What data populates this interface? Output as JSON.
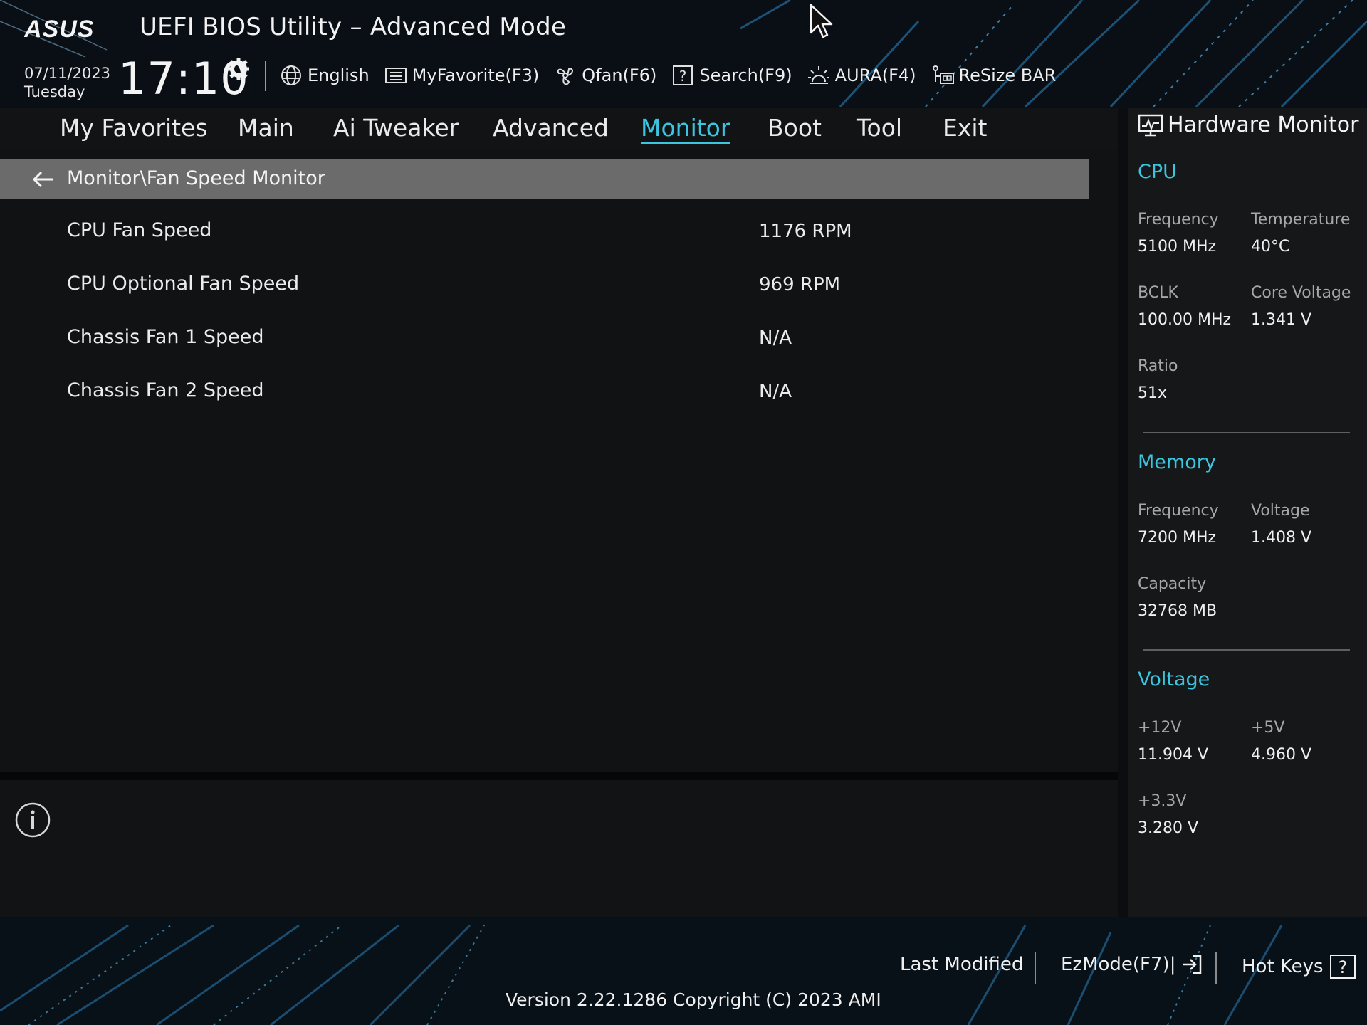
{
  "header": {
    "brand": "ASUS",
    "title": "UEFI BIOS Utility – Advanced Mode",
    "date": "07/11/2023",
    "weekday": "Tuesday",
    "time": "17:10",
    "toolbar": [
      {
        "icon": "globe-icon",
        "label": "English"
      },
      {
        "icon": "favorite-list-icon",
        "label": "MyFavorite(F3)"
      },
      {
        "icon": "fan-icon",
        "label": "Qfan(F6)"
      },
      {
        "icon": "question-box-icon",
        "label": "Search(F9)"
      },
      {
        "icon": "aura-light-icon",
        "label": "AURA(F4)"
      },
      {
        "icon": "resize-bar-icon",
        "label": "ReSize BAR"
      }
    ]
  },
  "tabs": [
    {
      "label": "My Favorites",
      "active": false
    },
    {
      "label": "Main",
      "active": false
    },
    {
      "label": "Ai Tweaker",
      "active": false
    },
    {
      "label": "Advanced",
      "active": false
    },
    {
      "label": "Monitor",
      "active": true
    },
    {
      "label": "Boot",
      "active": false
    },
    {
      "label": "Tool",
      "active": false
    },
    {
      "label": "Exit",
      "active": false
    }
  ],
  "breadcrumb": "Monitor\\Fan Speed Monitor",
  "rows": [
    {
      "label": "CPU Fan Speed",
      "value": "1176 RPM"
    },
    {
      "label": "CPU Optional Fan Speed",
      "value": "969 RPM"
    },
    {
      "label": "Chassis Fan 1 Speed",
      "value": "N/A"
    },
    {
      "label": "Chassis Fan 2 Speed",
      "value": "N/A"
    }
  ],
  "hardware_monitor": {
    "title": "Hardware Monitor",
    "cpu": {
      "title": "CPU",
      "frequency_label": "Frequency",
      "frequency": "5100 MHz",
      "temperature_label": "Temperature",
      "temperature": "40°C",
      "bclk_label": "BCLK",
      "bclk": "100.00 MHz",
      "core_voltage_label": "Core Voltage",
      "core_voltage": "1.341 V",
      "ratio_label": "Ratio",
      "ratio": "51x"
    },
    "memory": {
      "title": "Memory",
      "frequency_label": "Frequency",
      "frequency": "7200 MHz",
      "voltage_label": "Voltage",
      "voltage": "1.408 V",
      "capacity_label": "Capacity",
      "capacity": "32768 MB"
    },
    "voltage": {
      "title": "Voltage",
      "v12_label": "+12V",
      "v12": "11.904 V",
      "v5_label": "+5V",
      "v5": "4.960 V",
      "v33_label": "+3.3V",
      "v33": "3.280 V"
    }
  },
  "footer": {
    "last_modified": "Last Modified",
    "ezmode": "EzMode(F7)|",
    "hotkeys": "Hot Keys",
    "version": "Version 2.22.1286 Copyright (C) 2023 AMI"
  },
  "colors": {
    "accent": "#3cc5de",
    "breadcrumb_bg": "#6b6b6b",
    "panel_bg": "#111213"
  }
}
